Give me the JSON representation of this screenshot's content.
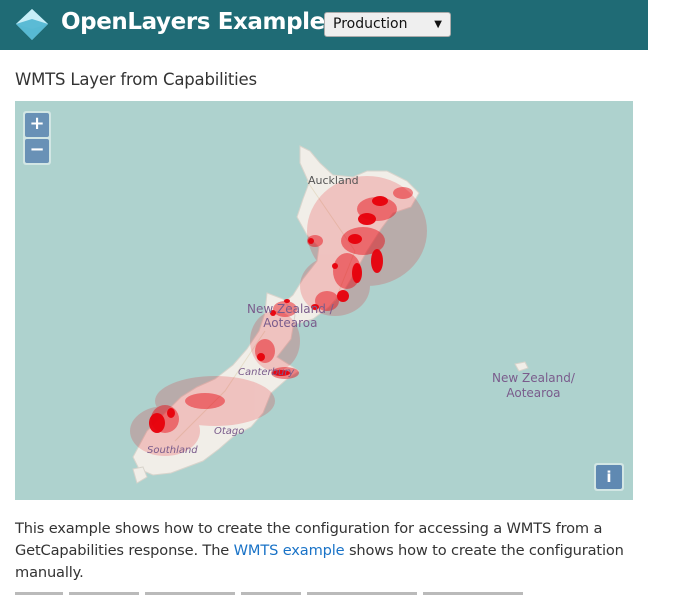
{
  "header": {
    "brand": "OpenLayers Examples",
    "version_select": {
      "value": "Production"
    },
    "background_color": "#1f6b75"
  },
  "page": {
    "title": "WMTS Layer from Capabilities"
  },
  "map": {
    "zoom_in_label": "+",
    "zoom_out_label": "−",
    "attribution_label": "i",
    "labels": {
      "auckland": "Auckland",
      "nz_line1": "New Zealand /",
      "nz_line2": "Aotearoa",
      "canterbury": "Canterbury",
      "otago": "Otago",
      "southland": "Southland",
      "nz_east_line1": "New Zealand/",
      "nz_east_line2": "Aotearoa"
    },
    "colors": {
      "sea": "#aed2ce",
      "land": "#f1eee8",
      "overlay": "#e8000b"
    }
  },
  "description": {
    "text_before": "This example shows how to create the configuration for accessing a WMTS from a GetCapabilities response. The ",
    "link": "WMTS example",
    "text_after": " shows how to create the configuration manually."
  }
}
